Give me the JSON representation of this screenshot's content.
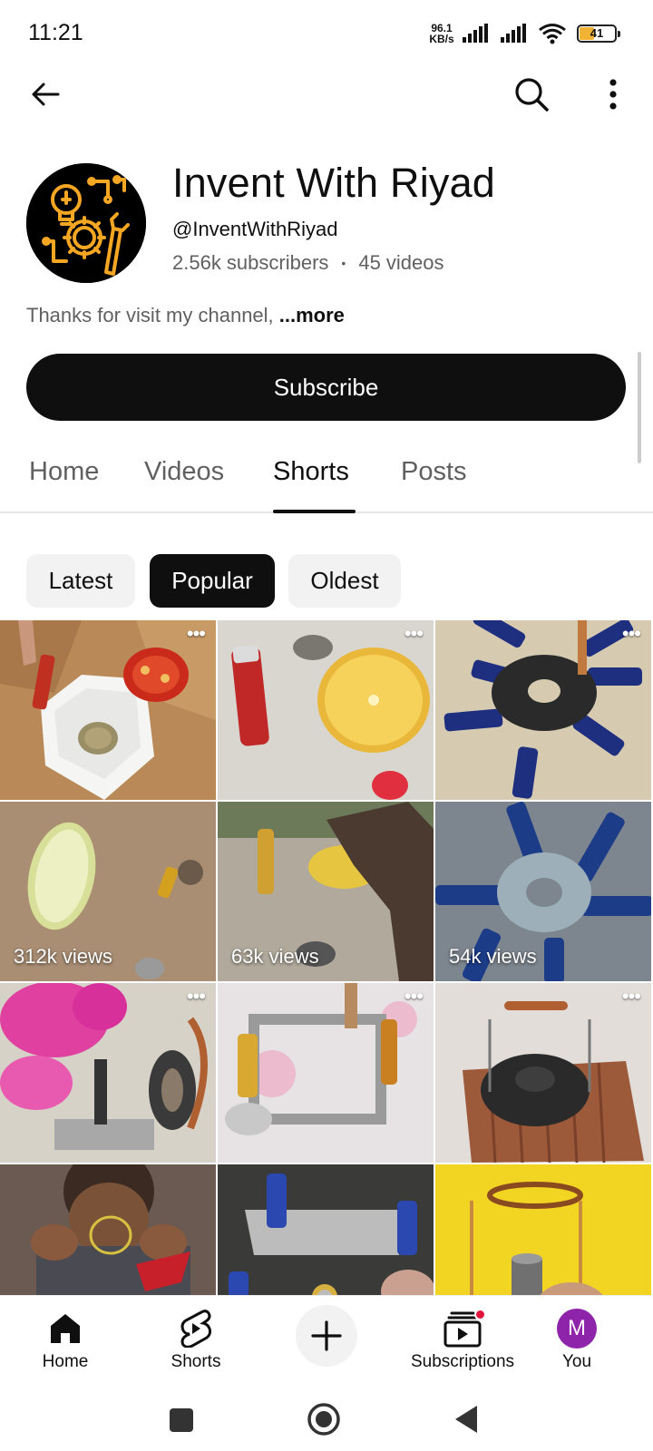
{
  "status_bar": {
    "time": "11:21",
    "net_speed_value": "96.1",
    "net_speed_unit": "KB/s",
    "battery_level": "41",
    "battery_fraction": 0.41
  },
  "top_bar": {
    "back_icon": "arrow-left-icon",
    "search_icon": "search-icon",
    "more_icon": "more-vertical-icon"
  },
  "channel": {
    "name": "Invent With Riyad",
    "handle": "@InventWithRiyad",
    "subscribers": "2.56k subscribers",
    "separator": "•",
    "videos": "45 videos",
    "description": "Thanks for visit my channel, ",
    "more_label": "...more",
    "subscribe_label": "Subscribe",
    "logo_colors": {
      "background": "#000000",
      "accent": "#f5a623"
    }
  },
  "tabs": [
    {
      "label": "Home"
    },
    {
      "label": "Videos"
    },
    {
      "label": "Shorts"
    },
    {
      "label": "Posts"
    }
  ],
  "filter_chips": [
    {
      "label": "Latest"
    },
    {
      "label": "Popular"
    },
    {
      "label": "Oldest"
    }
  ],
  "shorts": [
    {
      "views": "",
      "scene": "battery-tomato-hex-dish"
    },
    {
      "views": "",
      "scene": "battery-lemon-coin"
    },
    {
      "views": "",
      "scene": "batteries-around-magnet"
    },
    {
      "views": "312k views",
      "scene": "lemon-battery-table"
    },
    {
      "views": "63k views",
      "scene": "battery-lemon-finger"
    },
    {
      "views": "54k views",
      "scene": "batteries-star-magnet"
    },
    {
      "views": "",
      "scene": "pink-fan-motor"
    },
    {
      "views": "",
      "scene": "batteries-spoon-frame"
    },
    {
      "views": "",
      "scene": "magnet-coil-wood"
    },
    {
      "views": "",
      "scene": "person-coil-wire"
    },
    {
      "views": "",
      "scene": "batteries-spoons-coin"
    },
    {
      "views": "",
      "scene": "copper-coil-yellow"
    }
  ],
  "bottom_nav": [
    {
      "label": "Home",
      "icon": "home-filled-icon"
    },
    {
      "label": "Shorts",
      "icon": "shorts-icon"
    },
    {
      "label": "",
      "icon": "plus-icon"
    },
    {
      "label": "Subscriptions",
      "icon": "subscriptions-icon"
    },
    {
      "label": "You",
      "icon": "avatar",
      "avatar_letter": "M",
      "avatar_color": "#8e24aa"
    }
  ],
  "system_nav": {
    "recents_icon": "square-icon",
    "home_icon": "circle-icon",
    "back_icon": "triangle-back-icon"
  }
}
